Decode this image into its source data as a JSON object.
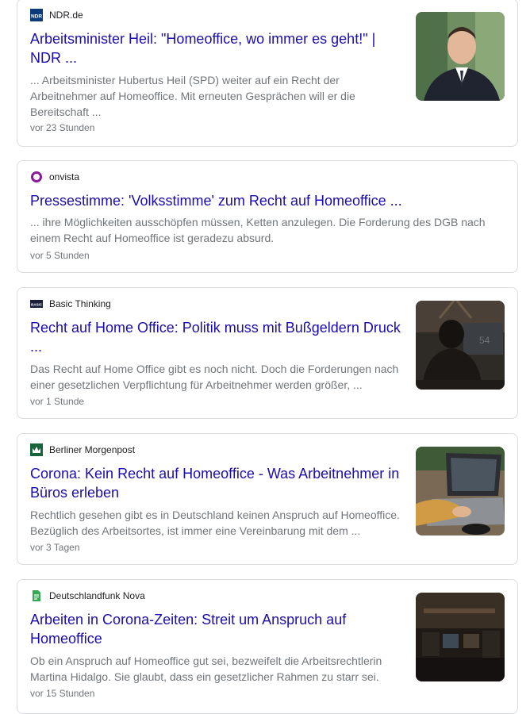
{
  "results": [
    {
      "source": "NDR.de",
      "title": "Arbeitsminister Heil: \"Homeoffice, wo immer es geht!\" | NDR ...",
      "snippet": "... Arbeitsminister Hubertus Heil (SPD) weiter auf ein Recht der Arbeitnehmer auf Homeoffice. Mit erneuten Gesprächen will er die Bereitschaft ...",
      "time": "vor 23 Stunden",
      "logo_icon": "ndr-logo",
      "thumbnail": "portrait-photo"
    },
    {
      "source": "onvista",
      "title": "Pressestimme: 'Volksstimme' zum Recht auf Homeoffice ...",
      "snippet": "... ihre Möglichkeiten ausschöpfen müssen, Ketten anzulegen. Die Forderung des DGB nach einem Recht auf Homeoffice ist geradezu absurd.",
      "time": "vor 5 Stunden",
      "logo_icon": "onvista-logo"
    },
    {
      "source": "Basic Thinking",
      "title": "Recht auf Home Office: Politik muss mit Bußgeldern Druck ...",
      "snippet": "Das Recht auf Home Office gibt es noch nicht. Doch die Forderungen nach einer gesetzlichen Verpflichtung für Arbeitnehmer werden größer, ...",
      "time": "vor 1 Stunde",
      "logo_icon": "basic-thinking-logo",
      "thumbnail": "person-at-monitor-photo"
    },
    {
      "source": "Berliner Morgenpost",
      "title": "Corona: Kein Recht auf Homeoffice - Was Arbeitnehmer in Büros erleben",
      "snippet": "Rechtlich gesehen gibt es in Deutschland keinen Anspruch auf Homeoffice. Bezüglich des Arbeitsortes, ist immer eine Vereinbarung mit dem ...",
      "time": "vor 3 Tagen",
      "logo_icon": "berliner-morgenpost-logo",
      "thumbnail": "laptop-typing-photo"
    },
    {
      "source": "Deutschlandfunk Nova",
      "title": "Arbeiten in Corona-Zeiten: Streit um Anspruch auf Homeoffice",
      "snippet": "Ob ein Anspruch auf Homeoffice gut sei, bezweifelt die Arbeitsrechtlerin Martina Hidalgo. Sie glaubt, dass ein gesetzlicher Rahmen zu starr sei.",
      "time": "vor 15 Stunden",
      "logo_icon": "document-logo",
      "thumbnail": "dark-office-photo"
    }
  ],
  "colors": {
    "title": "#1a0dab",
    "snippet": "#70757a",
    "border": "#dadce0"
  }
}
